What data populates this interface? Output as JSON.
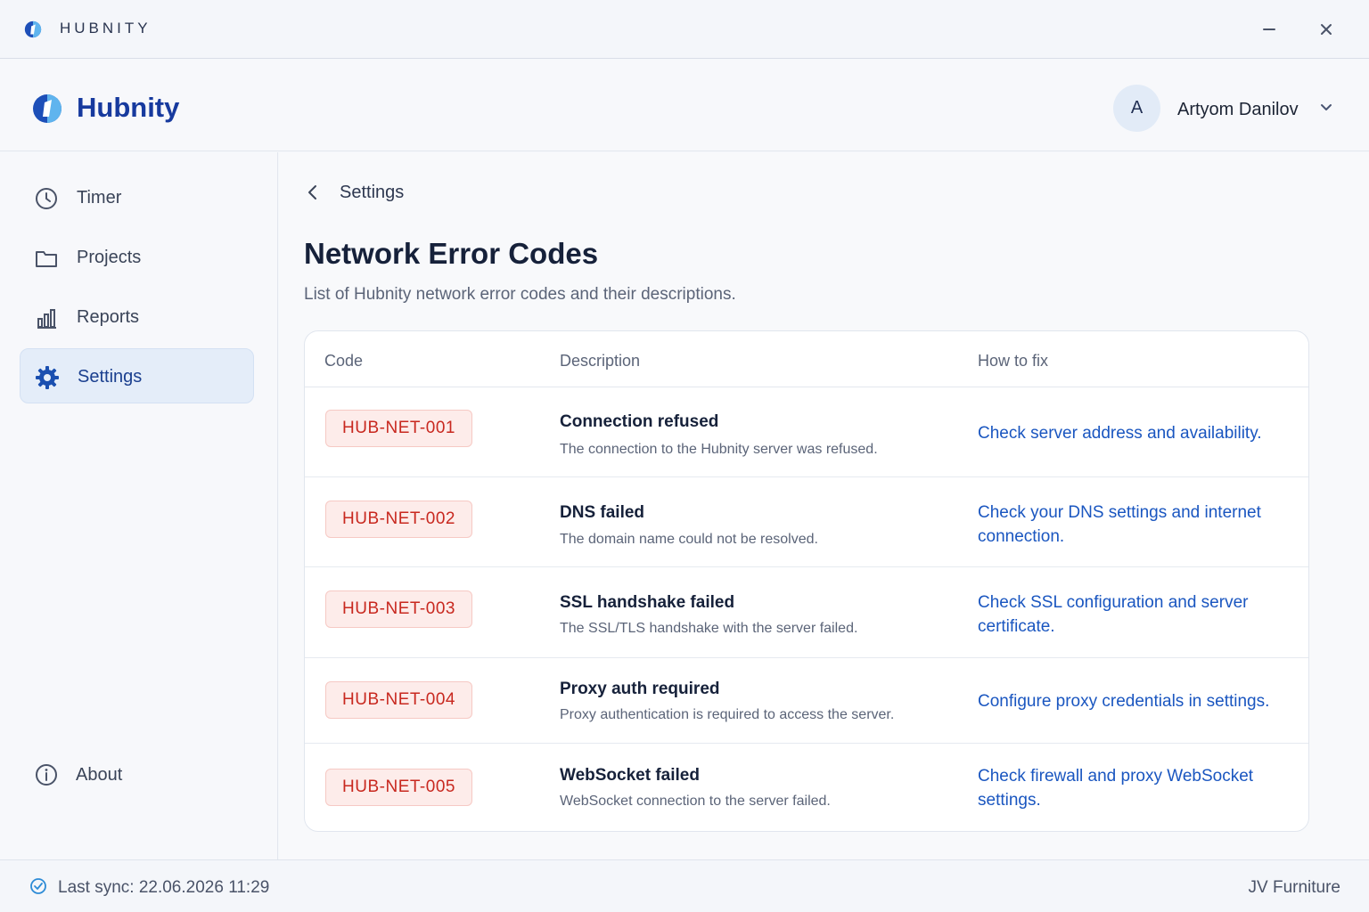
{
  "window": {
    "title": "HUBNITY",
    "minimize_icon": "minimize-icon",
    "close_icon": "close-icon"
  },
  "header": {
    "brand": "Hubnity",
    "user": {
      "initial": "A",
      "name": "Artyom Danilov"
    }
  },
  "sidebar": {
    "items": [
      {
        "label": "Timer",
        "icon": "clock-icon"
      },
      {
        "label": "Projects",
        "icon": "folder-icon"
      },
      {
        "label": "Reports",
        "icon": "bar-chart-icon"
      },
      {
        "label": "Settings",
        "icon": "gear-icon",
        "active": true
      }
    ],
    "about": {
      "label": "About",
      "icon": "info-icon"
    }
  },
  "main": {
    "breadcrumb": "Settings",
    "title": "Network Error Codes",
    "subtitle": "List of Hubnity network error codes and their descriptions.",
    "table": {
      "headers": {
        "code": "Code",
        "description": "Description",
        "fix": "How to fix"
      },
      "rows": [
        {
          "code": "HUB-NET-001",
          "title": "Connection refused",
          "desc": "The connection to the Hubnity server was refused.",
          "fix": "Check server address and availability."
        },
        {
          "code": "HUB-NET-002",
          "title": "DNS failed",
          "desc": "The domain name could not be resolved.",
          "fix": "Check your DNS settings and internet connection."
        },
        {
          "code": "HUB-NET-003",
          "title": "SSL handshake failed",
          "desc": "The SSL/TLS handshake with the server failed.",
          "fix": "Check SSL configuration and server certificate."
        },
        {
          "code": "HUB-NET-004",
          "title": "Proxy auth required",
          "desc": "Proxy authentication is required to access the server.",
          "fix": "Configure proxy credentials in settings."
        },
        {
          "code": "HUB-NET-005",
          "title": "WebSocket failed",
          "desc": "WebSocket connection to the server failed.",
          "fix": "Check firewall and proxy WebSocket settings."
        }
      ]
    }
  },
  "footer": {
    "sync": "Last sync: 22.06.2026 11:29",
    "workspace": "JV Furniture"
  },
  "colors": {
    "brand": "#173a9e",
    "accent": "#1a56c0",
    "error_badge_text": "#c8281f",
    "error_badge_bg": "#fdecea",
    "sync_ok": "#2d8bd6"
  }
}
